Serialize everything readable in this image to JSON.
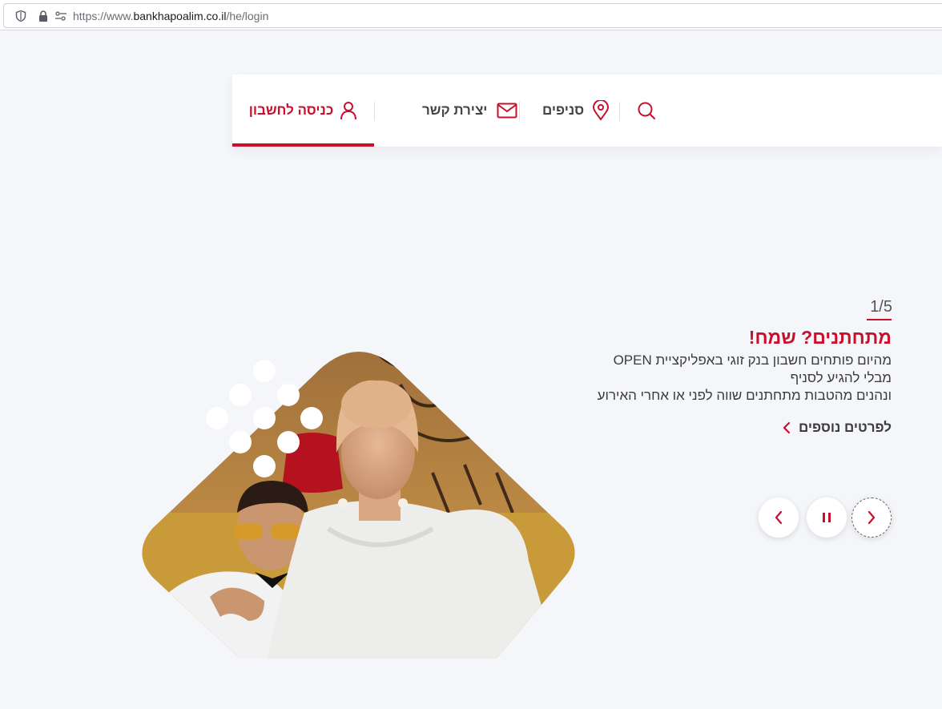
{
  "browser": {
    "url_prefix": "https://www.",
    "url_domain": "bankhapoalim.co.il",
    "url_path": "/he/login"
  },
  "nav": {
    "login_label": "כניסה לחשבון",
    "contact_label": "יצירת קשר",
    "branches_label": "סניפים"
  },
  "hero": {
    "counter": "1/5",
    "title": "מתחתנים? שמח!",
    "lines": [
      "מהיום פותחים חשבון בנק זוגי באפליקציית OPEN",
      "מבלי להגיע לסניף",
      "ונהנים מהטבות מתחתנים שווה לפני או אחרי האירוע"
    ],
    "more_label": "לפרטים נוספים"
  },
  "colors": {
    "brand_red": "#c8102e",
    "background": "#f4f6f9"
  },
  "icons": [
    "search-icon",
    "location-pin-icon",
    "envelope-icon",
    "user-icon",
    "chevron-left-icon",
    "pause-icon",
    "chevron-right-icon",
    "shield-icon",
    "lock-icon",
    "site-settings-icon"
  ]
}
